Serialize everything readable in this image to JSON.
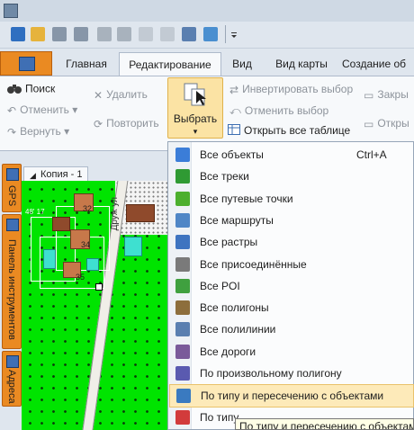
{
  "ribbon_tabs": [
    "Главная",
    "Редактирование",
    "Вид",
    "Вид карты",
    "Создание об"
  ],
  "ribbon": {
    "search": "Поиск",
    "undo": "Отменить",
    "redo": "Вернуть",
    "delete": "Удалить",
    "repeat": "Повторить",
    "select": "Выбрать",
    "invert": "Инвертировать выбор",
    "cancel_select": "Отменить выбор",
    "open_all_table": "Открыть все таблице",
    "close": "Закры",
    "open": "Откры"
  },
  "side_tabs": [
    "GPS",
    "Панель инструментов",
    "Адреса"
  ],
  "doc_tab": "Копия - 1",
  "map": {
    "house_numbers": [
      "32",
      "34",
      "35"
    ],
    "street_label": "Друж ул",
    "coord_text": "48' 17"
  },
  "menu_items": [
    {
      "label": "Все объекты",
      "shortcut": "Ctrl+A",
      "icon": "all-objects-icon",
      "color": "#3b7dd8"
    },
    {
      "label": "Все треки",
      "icon": "track-icon",
      "color": "#2f9a33"
    },
    {
      "label": "Все путевые точки",
      "icon": "waypoint-flag-icon",
      "color": "#4caf2e"
    },
    {
      "label": "Все маршруты",
      "icon": "route-icon",
      "color": "#4f86c6"
    },
    {
      "label": "Все растры",
      "icon": "raster-icon",
      "color": "#3e74c0"
    },
    {
      "label": "Все присоединённые",
      "icon": "paperclip-icon",
      "color": "#7a7a7a"
    },
    {
      "label": "Все POI",
      "icon": "poi-flag-icon",
      "color": "#3fa03f"
    },
    {
      "label": "Все полигоны",
      "icon": "polygon-icon",
      "color": "#8d6e3c"
    },
    {
      "label": "Все полилинии",
      "icon": "polyline-icon",
      "color": "#5a7fb0"
    },
    {
      "label": "Все дороги",
      "icon": "road-icon",
      "color": "#7a5a9a"
    },
    {
      "label": "По произвольному полигону",
      "icon": "custom-polygon-icon",
      "color": "#5a5ab0"
    },
    {
      "label": "По типу и пересечению с объектами",
      "icon": "intersect-icon",
      "color": "#3a7ac0"
    },
    {
      "label": "По типу",
      "icon": "type-flag-icon",
      "color": "#d23b3b"
    }
  ],
  "tooltip": "По типу и пересечению с объектам"
}
